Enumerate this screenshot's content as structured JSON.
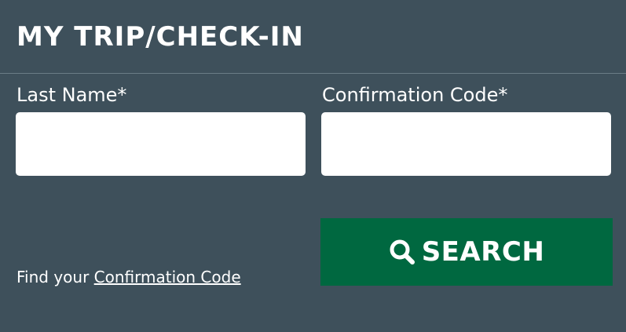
{
  "header": {
    "title": "MY TRIP/CHECK-IN"
  },
  "form": {
    "last_name": {
      "label": "Last Name*",
      "value": "",
      "placeholder": ""
    },
    "confirmation_code": {
      "label": "Confirmation Code*",
      "value": "",
      "placeholder": ""
    }
  },
  "help": {
    "prefix": "Find your ",
    "link_text": "Confirmation Code"
  },
  "search_button": {
    "label": "SEARCH",
    "icon": "search-icon"
  },
  "colors": {
    "background": "#3e505b",
    "button": "#006840",
    "text": "#ffffff",
    "input_background": "#ffffff"
  }
}
